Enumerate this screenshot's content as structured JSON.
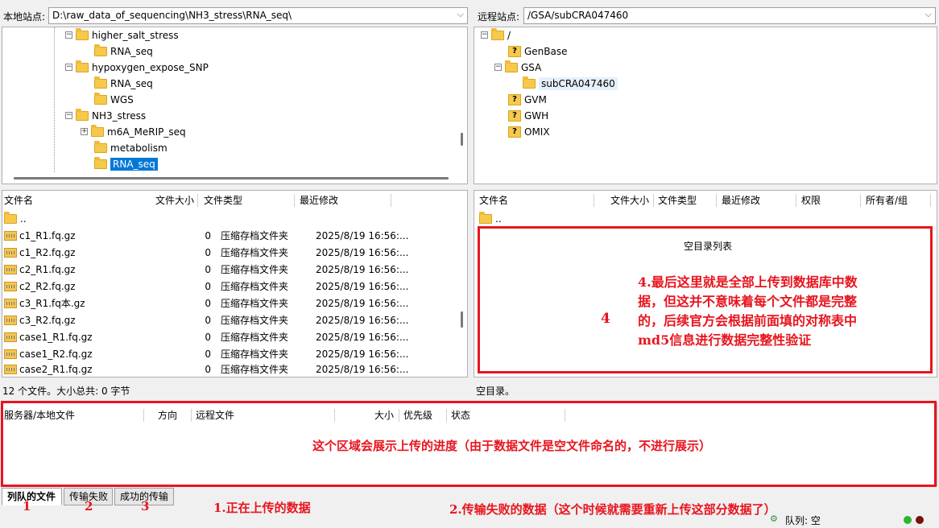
{
  "local": {
    "site_label": "本地站点:",
    "path": "D:\\raw_data_of_sequencing\\NH3_stress\\RNA_seq\\",
    "tree": [
      {
        "label": "higher_salt_stress"
      },
      {
        "label": "RNA_seq"
      },
      {
        "label": "hypoxygen_expose_SNP"
      },
      {
        "label": "RNA_seq"
      },
      {
        "label": "WGS"
      },
      {
        "label": "NH3_stress"
      },
      {
        "label": "m6A_MeRIP_seq"
      },
      {
        "label": "metabolism"
      },
      {
        "label": "RNA_seq"
      }
    ],
    "columns": [
      "文件名",
      "文件大小",
      "文件类型",
      "最近修改"
    ],
    "parent": "..",
    "files": [
      {
        "name": "c1_R1.fq.gz",
        "size": "0",
        "type": "压缩存档文件夹",
        "modified": "2025/8/19 16:56:..."
      },
      {
        "name": "c1_R2.fq.gz",
        "size": "0",
        "type": "压缩存档文件夹",
        "modified": "2025/8/19 16:56:..."
      },
      {
        "name": "c2_R1.fq.gz",
        "size": "0",
        "type": "压缩存档文件夹",
        "modified": "2025/8/19 16:56:..."
      },
      {
        "name": "c2_R2.fq.gz",
        "size": "0",
        "type": "压缩存档文件夹",
        "modified": "2025/8/19 16:56:..."
      },
      {
        "name": "c3_R1.fq本.gz",
        "size": "0",
        "type": "压缩存档文件夹",
        "modified": "2025/8/19 16:56:..."
      },
      {
        "name": "c3_R2.fq.gz",
        "size": "0",
        "type": "压缩存档文件夹",
        "modified": "2025/8/19 16:56:..."
      },
      {
        "name": "case1_R1.fq.gz",
        "size": "0",
        "type": "压缩存档文件夹",
        "modified": "2025/8/19 16:56:..."
      },
      {
        "name": "case1_R2.fq.gz",
        "size": "0",
        "type": "压缩存档文件夹",
        "modified": "2025/8/19 16:56:..."
      },
      {
        "name": "case2_R1.fq.gz",
        "size": "0",
        "type": "压缩存档文件夹",
        "modified": "2025/8/19 16:56:..."
      }
    ],
    "status": "12 个文件。大小总共: 0 字节"
  },
  "remote": {
    "site_label": "远程站点:",
    "path": "/GSA/subCRA047460",
    "tree": [
      {
        "label": "/"
      },
      {
        "label": "GenBase"
      },
      {
        "label": "GSA"
      },
      {
        "label": "subCRA047460"
      },
      {
        "label": "GVM"
      },
      {
        "label": "GWH"
      },
      {
        "label": "OMIX"
      }
    ],
    "columns": [
      "文件名",
      "文件大小",
      "文件类型",
      "最近修改",
      "权限",
      "所有者/组"
    ],
    "parent": "..",
    "empty_text": "空目录列表",
    "status": "空目录。"
  },
  "queue": {
    "columns": [
      "服务器/本地文件",
      "方向",
      "远程文件",
      "大小",
      "优先级",
      "状态"
    ],
    "tabs": [
      "列队的文件",
      "传输失败",
      "成功的传输"
    ],
    "queue_status": "队列: 空"
  },
  "annotations": {
    "box4_number": "4",
    "box4_lines": [
      "4.最后这里就是全部上传到数据库中数",
      "据，但这并不意味着每个文件都是完整",
      "的，后续官方会根据前面填的对称表中",
      "md5信息进行数据完整性验证"
    ],
    "queue_note": "这个区域会展示上传的进度（由于数据文件是空文件命名的，不进行展示）",
    "tab_numbers": [
      "1",
      "2",
      "3"
    ],
    "note1": "1.正在上传的数据",
    "note2": "2.传输失败的数据（这个时候就需要重新上传这部分数据了）"
  },
  "colors": {
    "accent": "#0078d7",
    "annotation": "#e8141e",
    "folder": "#f6c94b"
  },
  "icons": {
    "chevron": "chevron-down-icon",
    "folder": "folder-icon",
    "unknown_folder": "unknown-folder-icon",
    "archive": "archive-icon"
  }
}
